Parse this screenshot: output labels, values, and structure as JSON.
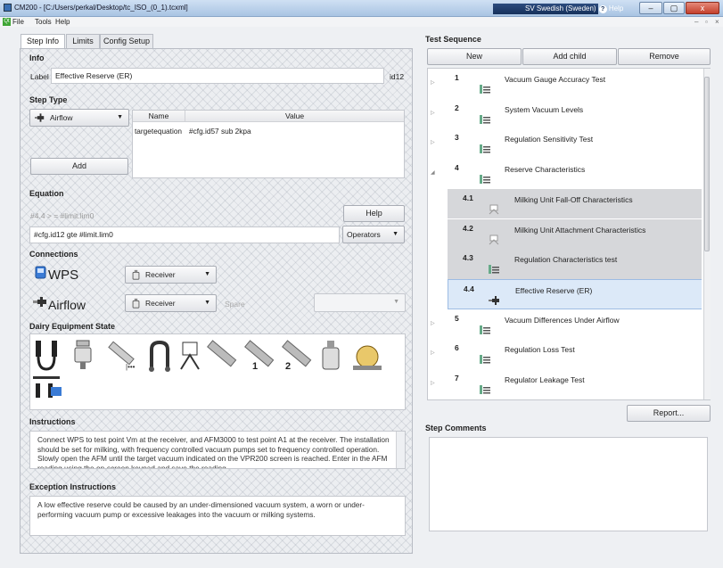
{
  "window": {
    "title": "CM200 - [C:/Users/perkal/Desktop/tc_ISO_(0_1).tcxml]",
    "lang": "SV Swedish (Sweden)",
    "help": "Help",
    "min": "–",
    "max": "▢",
    "close": "x"
  },
  "menu": {
    "file": "File",
    "tools": "Tools",
    "help": "Help"
  },
  "tabs": [
    "Step Info",
    "Limits",
    "Config Setup"
  ],
  "info": {
    "section": "Info",
    "label_caption": "Label",
    "label_value": "Effective Reserve (ER)",
    "id": "id12"
  },
  "step_type": {
    "section": "Step Type",
    "selected": "Airflow",
    "add": "Add",
    "col_name": "Name",
    "col_value": "Value",
    "rows": [
      {
        "name": "targetequation",
        "value": "#cfg.id57 sub 2kpa"
      }
    ]
  },
  "equation": {
    "section": "Equation",
    "preview": "#4.4 > = #limit.lim0",
    "help": "Help",
    "value": "#cfg.id12 gte #limit.lim0",
    "operators": "Operators"
  },
  "connections": {
    "section": "Connections",
    "wps": "WPS",
    "airflow": "Airflow",
    "receiver1": "Receiver",
    "receiver2": "Receiver",
    "spare": "Spare"
  },
  "dairy": {
    "section": "Dairy Equipment State",
    "num1": "1",
    "num2": "2"
  },
  "instructions": {
    "section": "Instructions",
    "text": "Connect WPS to test point Vm at the receiver, and AFM3000 to test point A1 at the receiver. The installation should be set for milking, with frequency controlled vacuum pumps set to frequency controlled operation. Slowly open the AFM until the target vacuum indicated on the VPR200 screen is reached. Enter in the AFM reading using the on-screen keypad and save the reading."
  },
  "exception": {
    "section": "Exception Instructions",
    "text": "A low effective reserve could be caused by an under-dimensioned vacuum system, a worn or under-performing vacuum pump or excessive leakages into the vacuum or milking systems."
  },
  "sequence": {
    "section": "Test Sequence",
    "new": "New",
    "add_child": "Add child",
    "remove": "Remove",
    "report": "Report...",
    "comments": "Step Comments",
    "items": [
      {
        "num": "1",
        "label": "Vacuum Gauge Accuracy Test",
        "icon": "settings-icon"
      },
      {
        "num": "2",
        "label": "System Vacuum Levels",
        "icon": "settings-icon"
      },
      {
        "num": "3",
        "label": "Regulation Sensitivity Test",
        "icon": "settings-icon"
      },
      {
        "num": "4",
        "label": "Reserve Characteristics",
        "icon": "settings-icon"
      },
      {
        "num": "4.1",
        "label": "Milking Unit Fall-Off Characteristics",
        "icon": "gauge-icon"
      },
      {
        "num": "4.2",
        "label": "Milking Unit Attachment Characteristics",
        "icon": "gauge-icon"
      },
      {
        "num": "4.3",
        "label": "Regulation Characteristics test",
        "icon": "settings-icon"
      },
      {
        "num": "4.4",
        "label": "Effective Reserve (ER)",
        "icon": "airflow-icon"
      },
      {
        "num": "5",
        "label": "Vacuum Differences Under Airflow",
        "icon": "settings-icon"
      },
      {
        "num": "6",
        "label": "Regulation Loss Test",
        "icon": "settings-icon"
      },
      {
        "num": "7",
        "label": "Regulator Leakage Test",
        "icon": "settings-icon"
      }
    ]
  }
}
